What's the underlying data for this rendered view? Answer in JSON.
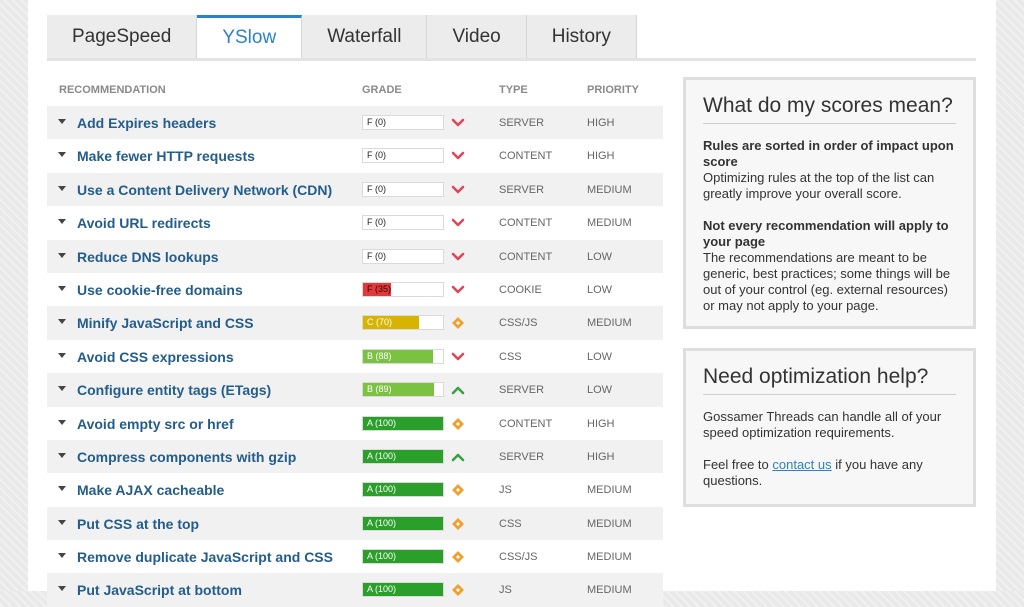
{
  "tabs": [
    "PageSpeed",
    "YSlow",
    "Waterfall",
    "Video",
    "History"
  ],
  "active_tab": 1,
  "table": {
    "headers": {
      "recommendation": "RECOMMENDATION",
      "grade": "GRADE",
      "type": "TYPE",
      "priority": "PRIORITY"
    },
    "rows": [
      {
        "name": "Add Expires headers",
        "grade": "F (0)",
        "score": 0,
        "icon": "chevron-down-icon",
        "type": "SERVER",
        "priority": "HIGH"
      },
      {
        "name": "Make fewer HTTP requests",
        "grade": "F (0)",
        "score": 0,
        "icon": "chevron-down-icon",
        "type": "CONTENT",
        "priority": "HIGH"
      },
      {
        "name": "Use a Content Delivery Network (CDN)",
        "grade": "F (0)",
        "score": 0,
        "icon": "chevron-down-icon",
        "type": "SERVER",
        "priority": "MEDIUM"
      },
      {
        "name": "Avoid URL redirects",
        "grade": "F (0)",
        "score": 0,
        "icon": "chevron-down-icon",
        "type": "CONTENT",
        "priority": "MEDIUM"
      },
      {
        "name": "Reduce DNS lookups",
        "grade": "F (0)",
        "score": 0,
        "icon": "chevron-down-icon",
        "type": "CONTENT",
        "priority": "LOW"
      },
      {
        "name": "Use cookie-free domains",
        "grade": "F (35)",
        "score": 35,
        "icon": "chevron-down-icon",
        "type": "COOKIE",
        "priority": "LOW"
      },
      {
        "name": "Minify JavaScript and CSS",
        "grade": "C (70)",
        "score": 70,
        "icon": "diamond-icon",
        "type": "CSS/JS",
        "priority": "MEDIUM"
      },
      {
        "name": "Avoid CSS expressions",
        "grade": "B (88)",
        "score": 88,
        "icon": "chevron-down-icon",
        "type": "CSS",
        "priority": "LOW"
      },
      {
        "name": "Configure entity tags (ETags)",
        "grade": "B (89)",
        "score": 89,
        "icon": "chevron-up-icon",
        "type": "SERVER",
        "priority": "LOW"
      },
      {
        "name": "Avoid empty src or href",
        "grade": "A (100)",
        "score": 100,
        "icon": "diamond-icon",
        "type": "CONTENT",
        "priority": "HIGH"
      },
      {
        "name": "Compress components with gzip",
        "grade": "A (100)",
        "score": 100,
        "icon": "chevron-up-icon",
        "type": "SERVER",
        "priority": "HIGH"
      },
      {
        "name": "Make AJAX cacheable",
        "grade": "A (100)",
        "score": 100,
        "icon": "diamond-icon",
        "type": "JS",
        "priority": "MEDIUM"
      },
      {
        "name": "Put CSS at the top",
        "grade": "A (100)",
        "score": 100,
        "icon": "diamond-icon",
        "type": "CSS",
        "priority": "MEDIUM"
      },
      {
        "name": "Remove duplicate JavaScript and CSS",
        "grade": "A (100)",
        "score": 100,
        "icon": "diamond-icon",
        "type": "CSS/JS",
        "priority": "MEDIUM"
      },
      {
        "name": "Put JavaScript at bottom",
        "grade": "A (100)",
        "score": 100,
        "icon": "diamond-icon",
        "type": "JS",
        "priority": "MEDIUM"
      }
    ]
  },
  "scores_box": {
    "title": "What do my scores mean?",
    "p1_bold": "Rules are sorted in order of impact upon score",
    "p1_text": "Optimizing rules at the top of the list can greatly improve your overall score.",
    "p2_bold": "Not every recommendation will apply to your page",
    "p2_text": "The recommendations are meant to be generic, best practices; some things will be out of your control (eg. external resources) or may not apply to your page."
  },
  "help_box": {
    "title": "Need optimization help?",
    "p1": "Gossamer Threads can handle all of your speed optimization requirements.",
    "p2_before": "Feel free to ",
    "p2_link": "contact us",
    "p2_after": " if you have any questions."
  },
  "colors": {
    "accent": "#2b83c6",
    "grade_a": "#2aa02a",
    "grade_b": "#7cc242",
    "grade_c": "#d6b400",
    "grade_f": "#e03a3a",
    "icon_red": "#e0465a",
    "icon_green": "#3aa040",
    "icon_orange": "#f0a030"
  }
}
